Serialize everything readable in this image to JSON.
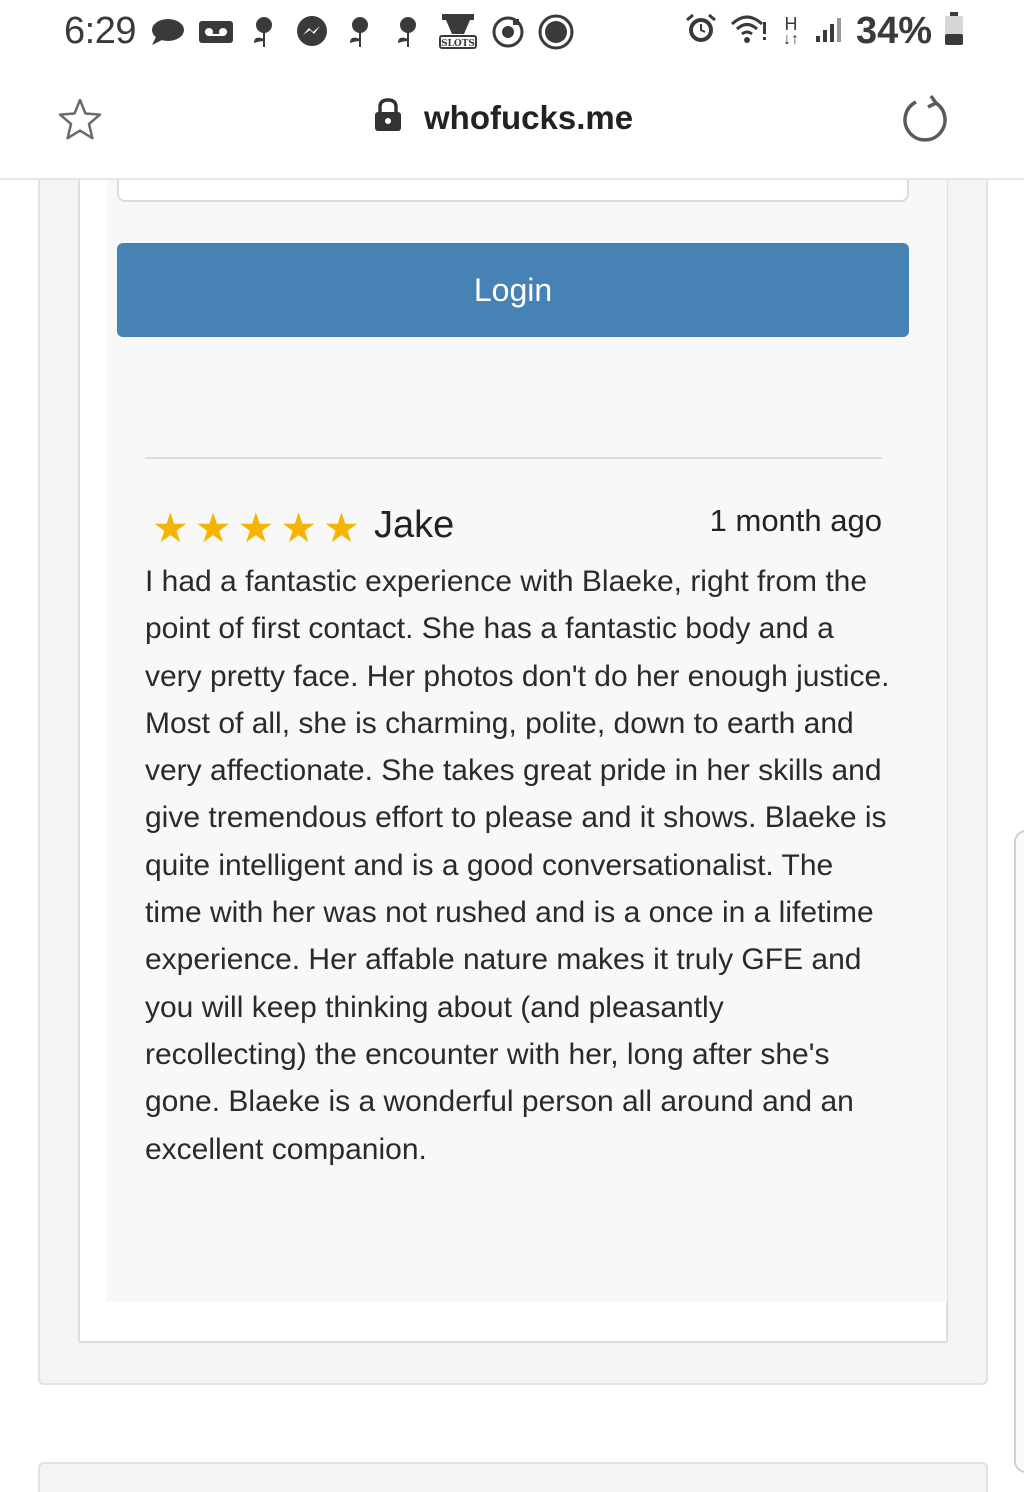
{
  "status_bar": {
    "time": "6:29",
    "battery": "34%",
    "network": "H",
    "notification_icons": [
      "chat-bubble-icon",
      "voicemail-icon",
      "rose-icon",
      "messenger-icon",
      "rose-icon",
      "rose-icon",
      "slots-app-icon",
      "dial-icon",
      "record-icon"
    ],
    "slots_label": "SLOTS"
  },
  "browser": {
    "url": "whofucks.me"
  },
  "form": {
    "login_label": "Login"
  },
  "review": {
    "rating": 5,
    "stars": [
      "★",
      "★",
      "★",
      "★",
      "★"
    ],
    "author": "Jake",
    "date": "1 month ago",
    "text": "I had a fantastic experience with Blaeke, right from the point of first contact. She has a fantastic body and a very pretty face. Her photos don't do her enough justice. Most of all, she is charming, polite, down to earth and very affectionate. She takes great pride in her skills and give tremendous effort to please and it shows. Blaeke is quite intelligent and is a good conversationalist. The time with her was not rushed and is a once in a lifetime experience. Her affable nature makes it truly GFE and you will keep thinking about (and pleasantly recollecting) the encounter with her, long after she's gone. Blaeke is a wonderful person all around and an excellent companion."
  },
  "colors": {
    "accent": "#4682b4",
    "star": "#f5b400"
  }
}
